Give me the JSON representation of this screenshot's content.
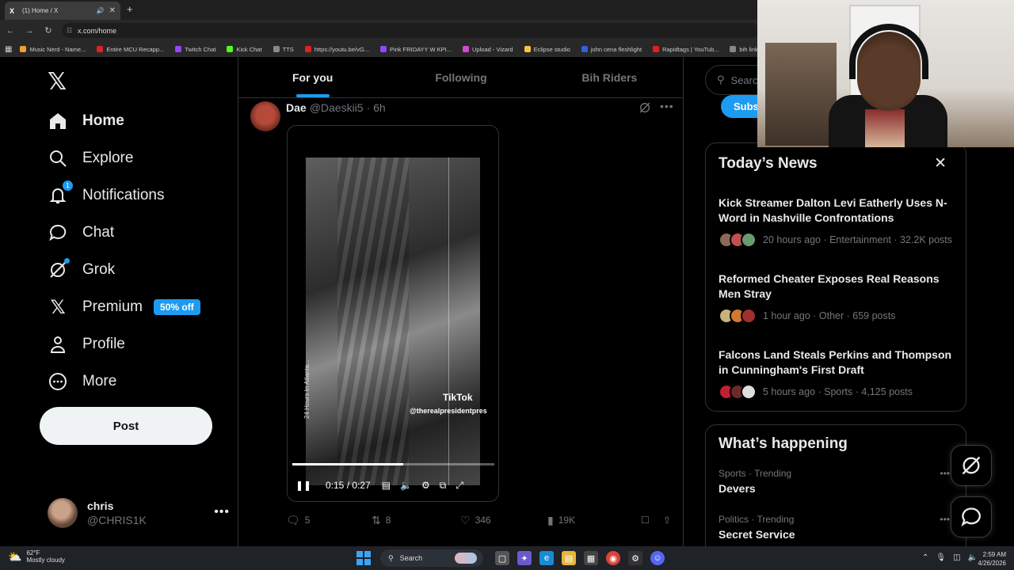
{
  "browser": {
    "tab_title": "(1) Home / X",
    "tab_favicon": "X",
    "url": "x.com/home",
    "bookmarks": [
      {
        "label": "Music Nerd - Name...",
        "color": "#f0a030"
      },
      {
        "label": "Entire MCU Recapp...",
        "color": "#e02020"
      },
      {
        "label": "Twitch Chat",
        "color": "#9146ff"
      },
      {
        "label": "Kick Chat",
        "color": "#53fc18"
      },
      {
        "label": "TTS",
        "color": "#888888"
      },
      {
        "label": "https://youtu.be/vG...",
        "color": "#e02020"
      },
      {
        "label": "Pink FRIDAYY W KPI...",
        "color": "#9146ff"
      },
      {
        "label": "Upload - Vizard",
        "color": "#d04bd0"
      },
      {
        "label": "Eclipse studio",
        "color": "#f5c542"
      },
      {
        "label": "john cena fleshlight",
        "color": "#3060e0"
      },
      {
        "label": "Rapidtags | YouTub...",
        "color": "#e02020"
      },
      {
        "label": "bih links",
        "color": "#888888"
      }
    ]
  },
  "nav": {
    "items": [
      {
        "label": "Home",
        "icon": "home-icon"
      },
      {
        "label": "Explore",
        "icon": "search-icon"
      },
      {
        "label": "Notifications",
        "icon": "bell-icon",
        "badge": "1"
      },
      {
        "label": "Chat",
        "icon": "chat-icon"
      },
      {
        "label": "Grok",
        "icon": "grok-icon"
      },
      {
        "label": "Premium",
        "icon": "x-icon",
        "pill": "50% off"
      },
      {
        "label": "Profile",
        "icon": "person-icon"
      },
      {
        "label": "More",
        "icon": "more-circle-icon"
      }
    ],
    "post_label": "Post",
    "account": {
      "name": "chris",
      "handle": "@CHRIS1K"
    }
  },
  "feed": {
    "tabs": [
      "For you",
      "Following",
      "Bih Riders"
    ],
    "tweet": {
      "name": "Dae",
      "handle": "@Daeskii5",
      "time": "· 6h",
      "video": {
        "watermark": "TikTok",
        "watermark_handle": "@therealpresidentpres",
        "side_text": "24 Hours In Atlanta...",
        "time": "0:15 / 0:27",
        "progress": 0.55
      },
      "replies": "5",
      "reposts": "8",
      "likes": "346",
      "views": "19K"
    }
  },
  "sidebar": {
    "search_placeholder": "Search",
    "subscribe_label": "Subscribe",
    "news_title": "Today’s News",
    "news": [
      {
        "title": "Kick Streamer Dalton Levi Eatherly Uses N-Word in Nashville Confrontations",
        "meta": "20 hours ago · Entertainment · 32.2K posts",
        "colors": [
          "#8a6a55",
          "#c05050",
          "#6a9a70"
        ]
      },
      {
        "title": "Reformed Cheater Exposes Real Reasons Men Stray",
        "meta": "1 hour ago · Other · 659 posts",
        "colors": [
          "#c9b27a",
          "#d07a30",
          "#a03030"
        ]
      },
      {
        "title": "Falcons Land Steals Perkins and Thompson in Cunningham's First Draft",
        "meta": "5 hours ago · Sports · 4,125 posts",
        "colors": [
          "#c02030",
          "#6a2a2a",
          "#dddddd"
        ]
      }
    ],
    "happening_title": "What’s happening",
    "happening": [
      {
        "category": "Sports · Trending",
        "title": "Devers"
      },
      {
        "category": "Politics · Trending",
        "title": "Secret Service"
      }
    ]
  },
  "taskbar": {
    "temp": "62°F",
    "weather": "Mostly cloudy",
    "search": "Search",
    "time": "2:59 AM",
    "date": "4/26/2026"
  }
}
